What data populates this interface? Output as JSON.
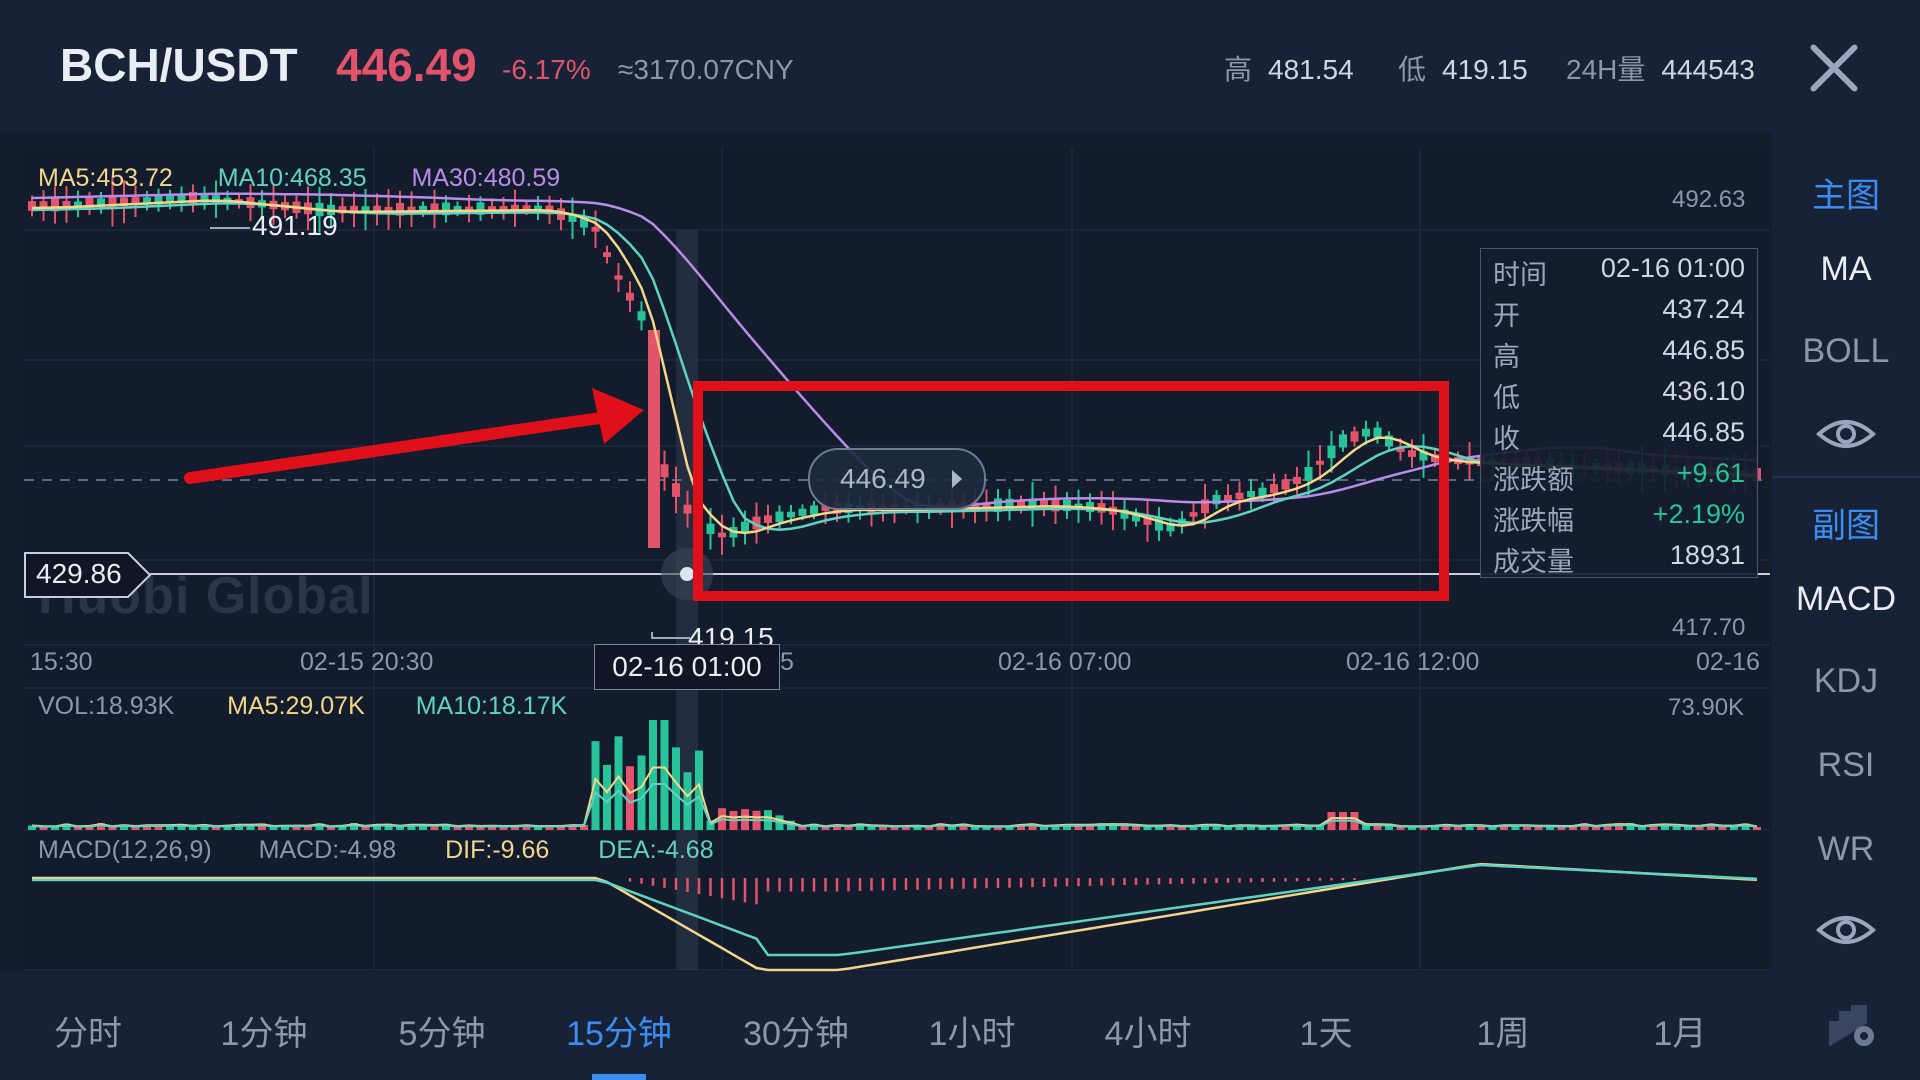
{
  "header": {
    "pair": "BCH/USDT",
    "price": "446.49",
    "change": "-6.17%",
    "cny": "≈3170.07CNY",
    "high_label": "高",
    "high": "481.54",
    "low_label": "低",
    "low": "419.15",
    "vol_label": "24H量",
    "vol": "444543"
  },
  "main_indicators": {
    "ma5": "MA5:453.72",
    "ma10": "MA10:468.35",
    "ma30": "MA30:480.59"
  },
  "price_axis": {
    "top": "492.63",
    "bottom": "417.70"
  },
  "annotations": {
    "max_label": "491.19",
    "min_label": "419.15",
    "current_price_tag": "429.86",
    "tooltip_price": "446.49",
    "watermark": "Huobi Global"
  },
  "time_axis": {
    "labels": [
      "15:30",
      "02-15 20:30",
      "5",
      "02-16 07:00",
      "02-16 12:00",
      "02-16"
    ],
    "crosshair": "02-16 01:00"
  },
  "info_box": {
    "rows": [
      {
        "k": "时间",
        "v": "02-16 01:00"
      },
      {
        "k": "开",
        "v": "437.24"
      },
      {
        "k": "高",
        "v": "446.85"
      },
      {
        "k": "低",
        "v": "436.10"
      },
      {
        "k": "收",
        "v": "446.85"
      },
      {
        "k": "涨跌额",
        "v": "+9.61"
      },
      {
        "k": "涨跌幅",
        "v": "+2.19%"
      },
      {
        "k": "成交量",
        "v": "18931"
      }
    ]
  },
  "volume_panel": {
    "vol": "VOL:18.93K",
    "ma5": "MA5:29.07K",
    "ma10": "MA10:18.17K",
    "max": "73.90K"
  },
  "macd_panel": {
    "title": "MACD(12,26,9)",
    "macd": "MACD:-4.98",
    "dif": "DIF:-9.66",
    "dea": "DEA:-4.68"
  },
  "sidebar": {
    "main_head": "主图",
    "main_items": [
      "MA",
      "BOLL"
    ],
    "sub_head": "副图",
    "sub_items": [
      "MACD",
      "KDJ",
      "RSI",
      "WR"
    ]
  },
  "timeframes": [
    "分时",
    "1分钟",
    "5分钟",
    "15分钟",
    "30分钟",
    "1小时",
    "4小时",
    "1天",
    "1周",
    "1月"
  ],
  "active_timeframe": "15分钟",
  "colors": {
    "up": "#27c49a",
    "down": "#e3546a",
    "ma5": "#f3d68a",
    "ma10": "#5fd3bf",
    "ma30": "#b98ce8",
    "accent": "#3b8df0",
    "annotation": "#e0101a"
  },
  "icons": {
    "close": "close-icon",
    "eye": "eye-icon",
    "settings": "chart-settings-icon"
  }
}
